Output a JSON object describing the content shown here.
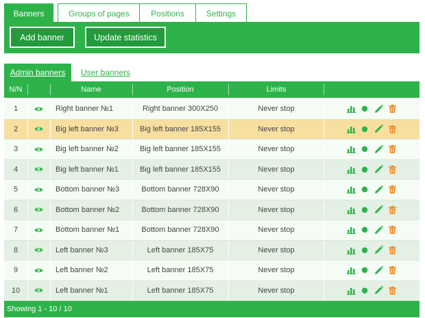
{
  "top_tabs": [
    {
      "label": "Banners",
      "active": true
    },
    {
      "label": "Groups of pages",
      "active": false
    },
    {
      "label": "Positions",
      "active": false
    },
    {
      "label": "Settings",
      "active": false
    }
  ],
  "toolbar": {
    "add_label": "Add banner",
    "update_label": "Update statistics"
  },
  "sub_tabs": [
    {
      "label": "Admin banners",
      "active": true
    },
    {
      "label": "User banners",
      "active": false
    }
  ],
  "table": {
    "headers": {
      "num": "N/N",
      "name": "Name",
      "position": "Position",
      "limits": "Limits"
    },
    "rows": [
      {
        "num": "1",
        "name": "Right banner №1",
        "position": "Right banner 300X250",
        "limits": "Never stop"
      },
      {
        "num": "2",
        "name": "Big left banner №3",
        "position": "Big left banner 185X155",
        "limits": "Never stop"
      },
      {
        "num": "3",
        "name": "Big left banner №2",
        "position": "Big left banner 185X155",
        "limits": "Never stop"
      },
      {
        "num": "4",
        "name": "Big left banner №1",
        "position": "Big left banner 185X155",
        "limits": "Never stop"
      },
      {
        "num": "5",
        "name": "Bottom banner №3",
        "position": "Bottom banner 728X90",
        "limits": "Never stop"
      },
      {
        "num": "6",
        "name": "Bottom banner №2",
        "position": "Bottom banner 728X90",
        "limits": "Never stop"
      },
      {
        "num": "7",
        "name": "Bottom banner №1",
        "position": "Bottom banner 728X90",
        "limits": "Never stop"
      },
      {
        "num": "8",
        "name": "Left banner №3",
        "position": "Left banner 185X75",
        "limits": "Never stop"
      },
      {
        "num": "9",
        "name": "Left banner №2",
        "position": "Left banner 185X75",
        "limits": "Never stop"
      },
      {
        "num": "10",
        "name": "Left banner №1",
        "position": "Left banner 185X75",
        "limits": "Never stop"
      }
    ],
    "highlighted_row": 2,
    "icons": {
      "visibility": "eye-icon",
      "stats": "bar-chart-icon",
      "status": "status-dot-icon",
      "edit": "pencil-icon",
      "delete": "trash-icon"
    }
  },
  "footer": {
    "showing": "Showing 1 - 10 / 10"
  },
  "colors": {
    "accent": "#2db34a",
    "accent_dark": "#239a3b",
    "highlight": "#f7dfa0",
    "delete": "#f08a24"
  }
}
